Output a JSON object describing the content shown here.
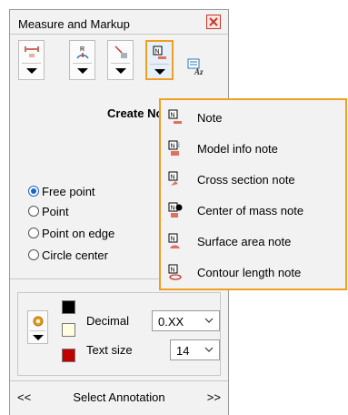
{
  "panel": {
    "title": "Measure and Markup",
    "heading": "Create Note",
    "radios": [
      {
        "label": "Free point",
        "selected": true
      },
      {
        "label": "Point",
        "selected": false
      },
      {
        "label": "Point on edge",
        "selected": false
      },
      {
        "label": "Circle center",
        "selected": false
      }
    ],
    "format": {
      "decimal_label": "Decimal",
      "decimal_value": "0.XX",
      "text_size_label": "Text size",
      "text_size_value": "14"
    },
    "bottom": {
      "prev": "<<",
      "label": "Select Annotation",
      "next": ">>"
    }
  },
  "menu": {
    "items": [
      {
        "label": "Note",
        "icon": "note-icon"
      },
      {
        "label": "Model info note",
        "icon": "model-info-note-icon"
      },
      {
        "label": "Cross section note",
        "icon": "cross-section-note-icon"
      },
      {
        "label": "Center of mass note",
        "icon": "center-of-mass-note-icon"
      },
      {
        "label": "Surface area note",
        "icon": "surface-area-note-icon"
      },
      {
        "label": "Contour length note",
        "icon": "contour-length-note-icon"
      }
    ]
  },
  "colors": {
    "accent": "#f0a020",
    "swatch_black": "#000000",
    "swatch_cream": "#fffde0",
    "swatch_red": "#c00000",
    "radio_blue": "#1e64c8"
  }
}
